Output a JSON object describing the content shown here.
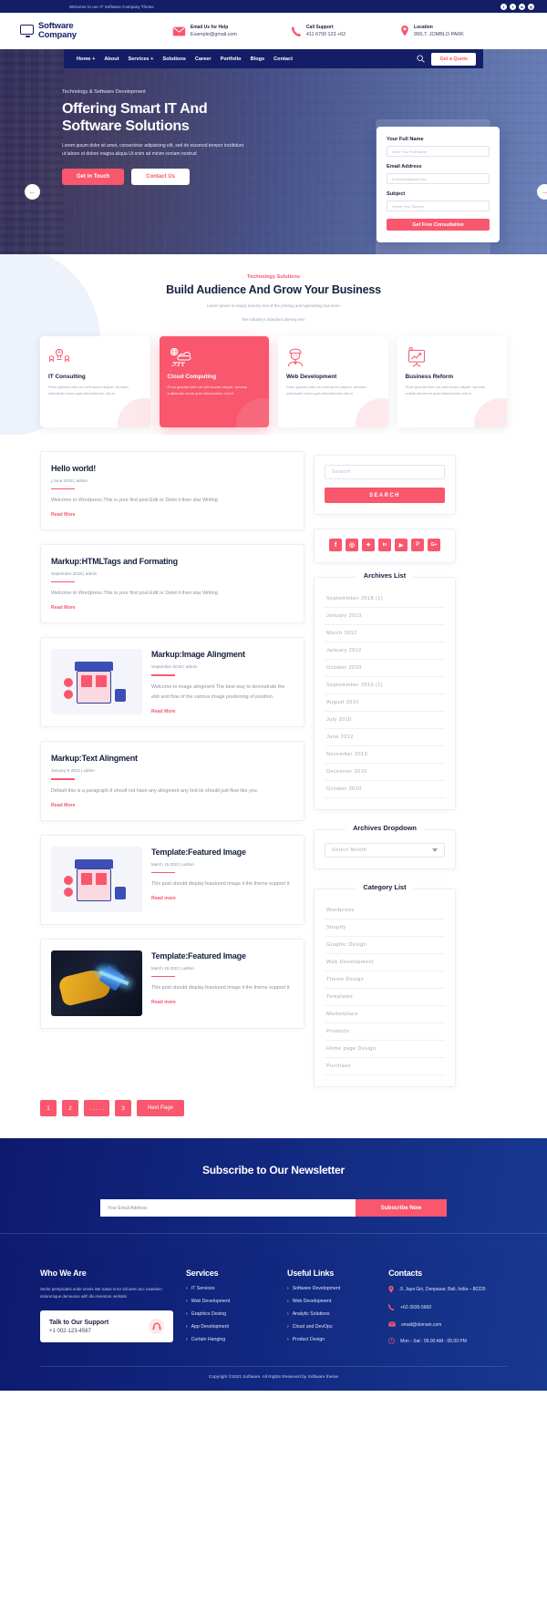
{
  "topbar": {
    "welcome": "Welcome to our IT Software Company Theme",
    "socials": [
      "f",
      "t",
      "in",
      "@"
    ]
  },
  "header": {
    "brand_line1": "Software",
    "brand_line2": "Company",
    "info": [
      {
        "icon": "envelope-icon",
        "label": "Email Us for Help",
        "value": "Example@gmail.com"
      },
      {
        "icon": "phone-icon",
        "label": "Call Support",
        "value": "411 6700 123 +62"
      },
      {
        "icon": "map-pin-icon",
        "label": "Location",
        "value": "99S.T. JOMBLO PARK"
      }
    ]
  },
  "nav": {
    "items": [
      "Home +",
      "About",
      "Services +",
      "Solutions",
      "Career",
      "Portfolio",
      "Blogs",
      "Contact"
    ],
    "quote_label": "Get a Quote"
  },
  "hero": {
    "kicker": "Technology & Software Development",
    "title": "Offering Smart IT And Software Solutions",
    "desc": "Lorem ipsum dolor sit amet, consectetur adipisicing elit, sed do eiusmod tempor incididunt ut labore et dolore magna aliqua Ut enim ad minim veniam nostrud",
    "btn_primary": "Get in Touch",
    "btn_secondary": "Contact Us",
    "form": {
      "name_label": "Your Full Name",
      "name_placeholder": "Enter Your Full Name",
      "email_label": "Email Address",
      "email_placeholder": "Example@gmail.com",
      "subject_label": "Subject",
      "subject_placeholder": "Select Your Subject",
      "submit_label": "Get Free Consultation"
    }
  },
  "solutions": {
    "kicker": "Technology Solutions",
    "title": "Build Audience And Grow Your Business",
    "subtitle_line1": "Lorem Ipsum is simply dummy text of the printing and typesetting has been",
    "subtitle_line2": "the industry's standard dummy text",
    "cards": [
      {
        "icon": "consulting-icon",
        "title": "IT Consulting",
        "desc": "Proin gravida nibh vel velit auctor aliquet. Aenean sollicitudin lorem quis bibendumtor nisi el",
        "active": false
      },
      {
        "icon": "cloud-icon",
        "title": "Cloud Computing",
        "desc": "Proin gravida nibh vel velit auctor aliquet. Aenean sollicitudin lorem quis bibendumtor nisi el",
        "active": true
      },
      {
        "icon": "developer-icon",
        "title": "Web Development",
        "desc": "Proin gravida nibh vel velit auctor aliquet. Aenean sollicitudin lorem quis bibendumtor nisi el",
        "active": false
      },
      {
        "icon": "chart-board-icon",
        "title": "Business Reform",
        "desc": "Proin gravida nibh vel velit auctor aliquet. Aenean sollicitudin lorem quis bibendumtor nisi el",
        "active": false
      }
    ]
  },
  "posts": [
    {
      "title": "Hello world!",
      "meta": "j.June 2018 | admin",
      "text": "Welcome to Wordpress.This is your first post.Edit or Delet it then star Writing",
      "more": "Read More",
      "thumb": null
    },
    {
      "title": "Markup:HTMLTags and Formating",
      "meta": "September 2018 | admin",
      "text": "Welcome to Wordpress.This is your first post.Edit or Delet it then star Writing",
      "more": "Read More",
      "thumb": null
    },
    {
      "title": "Markup:Image Alingment",
      "meta": "September 2018 | admin",
      "text": "Welcome to image alingment The best way to demostrate the ebb and flow of the various image postioning of position.",
      "more": "Read More",
      "thumb": "shop-illustration"
    },
    {
      "title": "Markup:Text Alingment",
      "meta": "January 9 2013 | admin",
      "text": "Default this is a paragraph.It shoutl not have any alingment   any lind its should just flow like you.",
      "more": "Read More",
      "thumb": null
    },
    {
      "title": "Template:Featured Image",
      "meta": "March 15 2021 | admin",
      "text": "This post should display feautured image it the theme support it",
      "more": "Read more",
      "thumb": "shop-illustration"
    },
    {
      "title": "Template:Featured Image",
      "meta": "March 15 2021 | admin",
      "text": "This post should display feautured image it the theme support it",
      "more": "Read more",
      "thumb": "welding-photo"
    }
  ],
  "pagination": [
    "1",
    "2",
    ". . . . .",
    "3"
  ],
  "pagination_next": "Next Page",
  "sidebar": {
    "search_placeholder": "Search",
    "search_button": "SEARCH",
    "socials": [
      "facebook-icon",
      "instagram-icon",
      "twitter-icon",
      "linkedin-icon",
      "youtube-icon",
      "pinterest-icon",
      "googleplus-icon"
    ],
    "archives_title": "Archives List",
    "archives": [
      "Septemmber 2018 (1)",
      "January 2013",
      "March 2012",
      "January 2012",
      "October 2010",
      "Septemmber 2010 (1)",
      "August 2010",
      "July 2010",
      "June 2012",
      "November 2013",
      "Decemver 2015",
      "October 2010"
    ],
    "dropdown_title": "Archives Dropdown",
    "dropdown_value": "Select Month",
    "category_title": "Category List",
    "categories": [
      "Wordpress",
      "Shopify",
      "Graphic Design",
      "Web Development",
      "Theme Design",
      "Templates",
      "Marketplace",
      "Products",
      "Home page Design",
      "Purchase"
    ]
  },
  "newsletter": {
    "title": "Subscribe to Our Newsletter",
    "placeholder": "Your Email Address",
    "button": "Subscribe  Now"
  },
  "footer": {
    "who_title": "Who We Are",
    "who_desc": "Sedut perspiciatis unde omnis iste natus error sitl.utem acc usantium doloremque denounce with illo inventore veritatis",
    "support_title": "Talk to Our Support",
    "support_phone": "+1 002-123-4567",
    "services_title": "Services",
    "services": [
      "IT Services",
      "Web Development",
      "Graphics Desing",
      "App Development",
      "Curtain Hanging"
    ],
    "links_title": "Useful Links",
    "links": [
      "Software Development",
      "Web Development",
      "Analytic Solutions",
      "Cloud and DevOps",
      "Product Design"
    ],
    "contacts_title": "Contacts",
    "contacts": [
      {
        "icon": "map-pin-icon",
        "text": "Jl. Jaya Giri, Denpasar, Bali, India – 80225"
      },
      {
        "icon": "phone-icon",
        "text": "+62-3939-5660"
      },
      {
        "icon": "envelope-icon",
        "text": "email@domain.com"
      },
      {
        "icon": "clock-icon",
        "text": "Mon - Sat : 09.00 AM - 05.00 PM"
      }
    ],
    "copyright": "Copyright ©2021 Software. All Rights Reserved by Software theme"
  },
  "colors": {
    "accent": "#f8576e",
    "navy": "#141e66",
    "deep": "#0d1a6e"
  }
}
